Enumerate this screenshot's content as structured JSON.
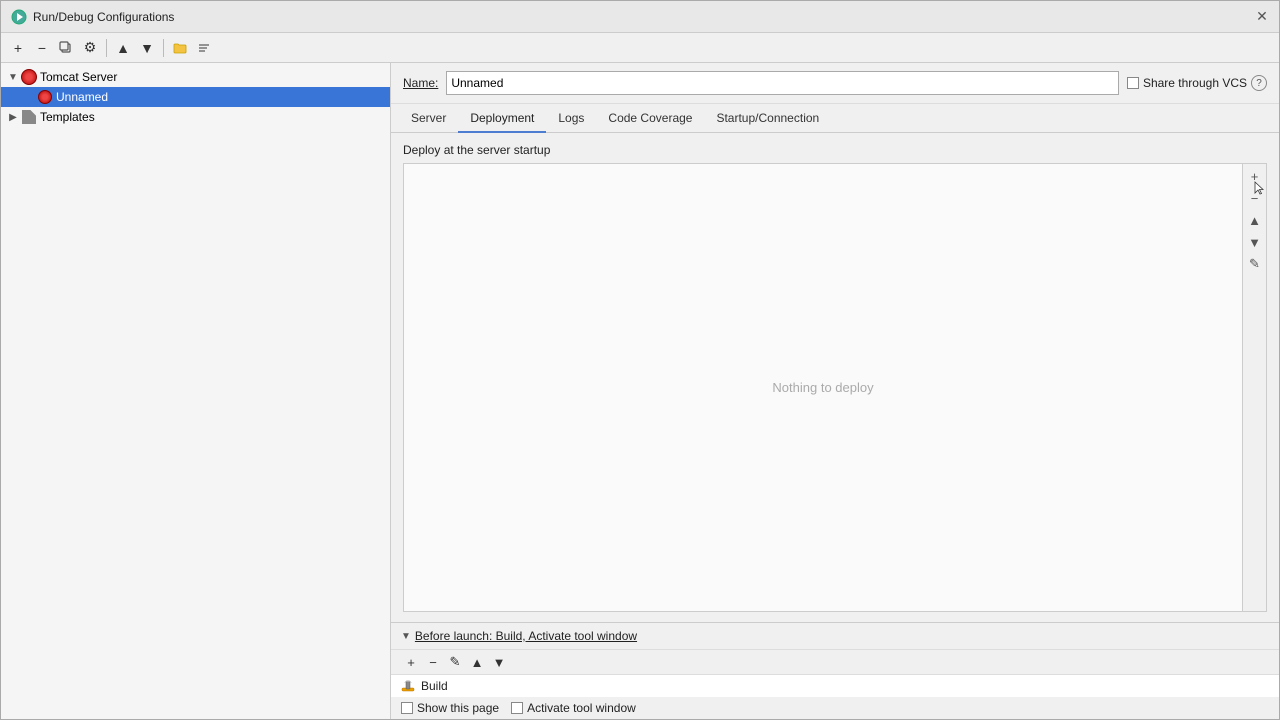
{
  "dialog": {
    "title": "Run/Debug Configurations",
    "title_icon": "run-debug-icon"
  },
  "toolbar": {
    "add_label": "+",
    "remove_label": "−",
    "copy_label": "⧉",
    "settings_label": "⚙",
    "move_up_label": "▲",
    "move_down_label": "▼",
    "folder_label": "📁",
    "sort_label": "⇅"
  },
  "tree": {
    "groups": [
      {
        "id": "tomcat-server",
        "label": "Tomcat Server",
        "expanded": true,
        "children": [
          {
            "id": "unnamed",
            "label": "Unnamed",
            "selected": true
          }
        ]
      },
      {
        "id": "templates",
        "label": "Templates",
        "expanded": false,
        "children": []
      }
    ]
  },
  "name_field": {
    "label": "Name:",
    "value": "Unnamed",
    "placeholder": ""
  },
  "vcs": {
    "label": "Share through VCS",
    "checked": false
  },
  "tabs": [
    {
      "id": "server",
      "label": "Server",
      "active": false
    },
    {
      "id": "deployment",
      "label": "Deployment",
      "active": true
    },
    {
      "id": "logs",
      "label": "Logs",
      "active": false
    },
    {
      "id": "code-coverage",
      "label": "Code Coverage",
      "active": false
    },
    {
      "id": "startup-connection",
      "label": "Startup/Connection",
      "active": false
    }
  ],
  "deploy": {
    "header": "Deploy at the server startup",
    "empty_text": "Nothing to deploy",
    "sidebar_buttons": [
      {
        "id": "add",
        "icon": "+"
      },
      {
        "id": "remove",
        "icon": "−"
      },
      {
        "id": "move-up",
        "icon": "▲"
      },
      {
        "id": "move-down",
        "icon": "▼"
      },
      {
        "id": "edit",
        "icon": "✎"
      }
    ]
  },
  "before_launch": {
    "label": "Before launch: Build, Activate tool window",
    "collapsed": false,
    "toolbar_buttons": [
      {
        "id": "add",
        "icon": "+"
      },
      {
        "id": "remove",
        "icon": "−"
      },
      {
        "id": "edit",
        "icon": "✎"
      },
      {
        "id": "move-up",
        "icon": "▲"
      },
      {
        "id": "move-down",
        "icon": "▼"
      }
    ],
    "items": [
      {
        "id": "build",
        "label": "Build"
      }
    ],
    "footer": {
      "show_page_label": "Show this page",
      "activate_window_label": "Activate tool window"
    }
  },
  "icons": {
    "run": "▶",
    "build": "🔨",
    "hammer": "🔨"
  }
}
